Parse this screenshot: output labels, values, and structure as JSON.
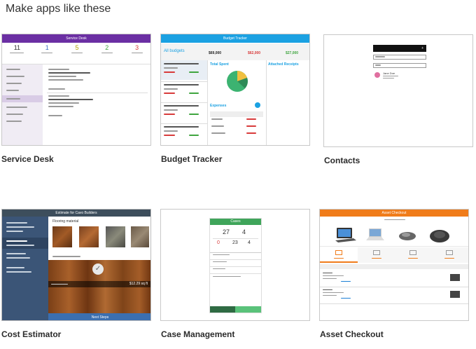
{
  "heading": "Make apps like these",
  "apps": [
    {
      "name": "Service Desk"
    },
    {
      "name": "Budget Tracker"
    },
    {
      "name": "Contacts"
    },
    {
      "name": "Cost Estimator"
    },
    {
      "name": "Case Management"
    },
    {
      "name": "Asset Checkout"
    }
  ],
  "service_desk": {
    "title": "Service Desk",
    "stats": [
      "11",
      "1",
      "5",
      "2",
      "3"
    ],
    "stat_colors": [
      "#333333",
      "#3b6fc6",
      "#b2a300",
      "#3fa53f",
      "#d83b3b"
    ]
  },
  "budget_tracker": {
    "title": "Budget Tracker",
    "all_budgets": "All budgets",
    "total_budget_amt": "$69,000",
    "spent_amt": "$62,000",
    "remaining_amt": "$27,000",
    "total_spent": "Total Spent",
    "attached_receipts": "Attached Receipts",
    "expenses": "Expenses",
    "pie_colors": [
      "#3cb371",
      "#f0c040",
      "#2e8b57"
    ]
  },
  "contacts": {
    "contact_name": "Jane Doe"
  },
  "cost_estimator": {
    "title": "Estimate for Cavo Builders",
    "subtitle": "Flooring material",
    "price": "$12.29 sq ft",
    "footer": "Next Steps"
  },
  "case_management": {
    "title": "Cases",
    "num1": "27",
    "num2": "4",
    "num3": "0",
    "num4": "23",
    "num5": "4"
  },
  "asset_checkout": {
    "title": "Asset Checkout"
  }
}
